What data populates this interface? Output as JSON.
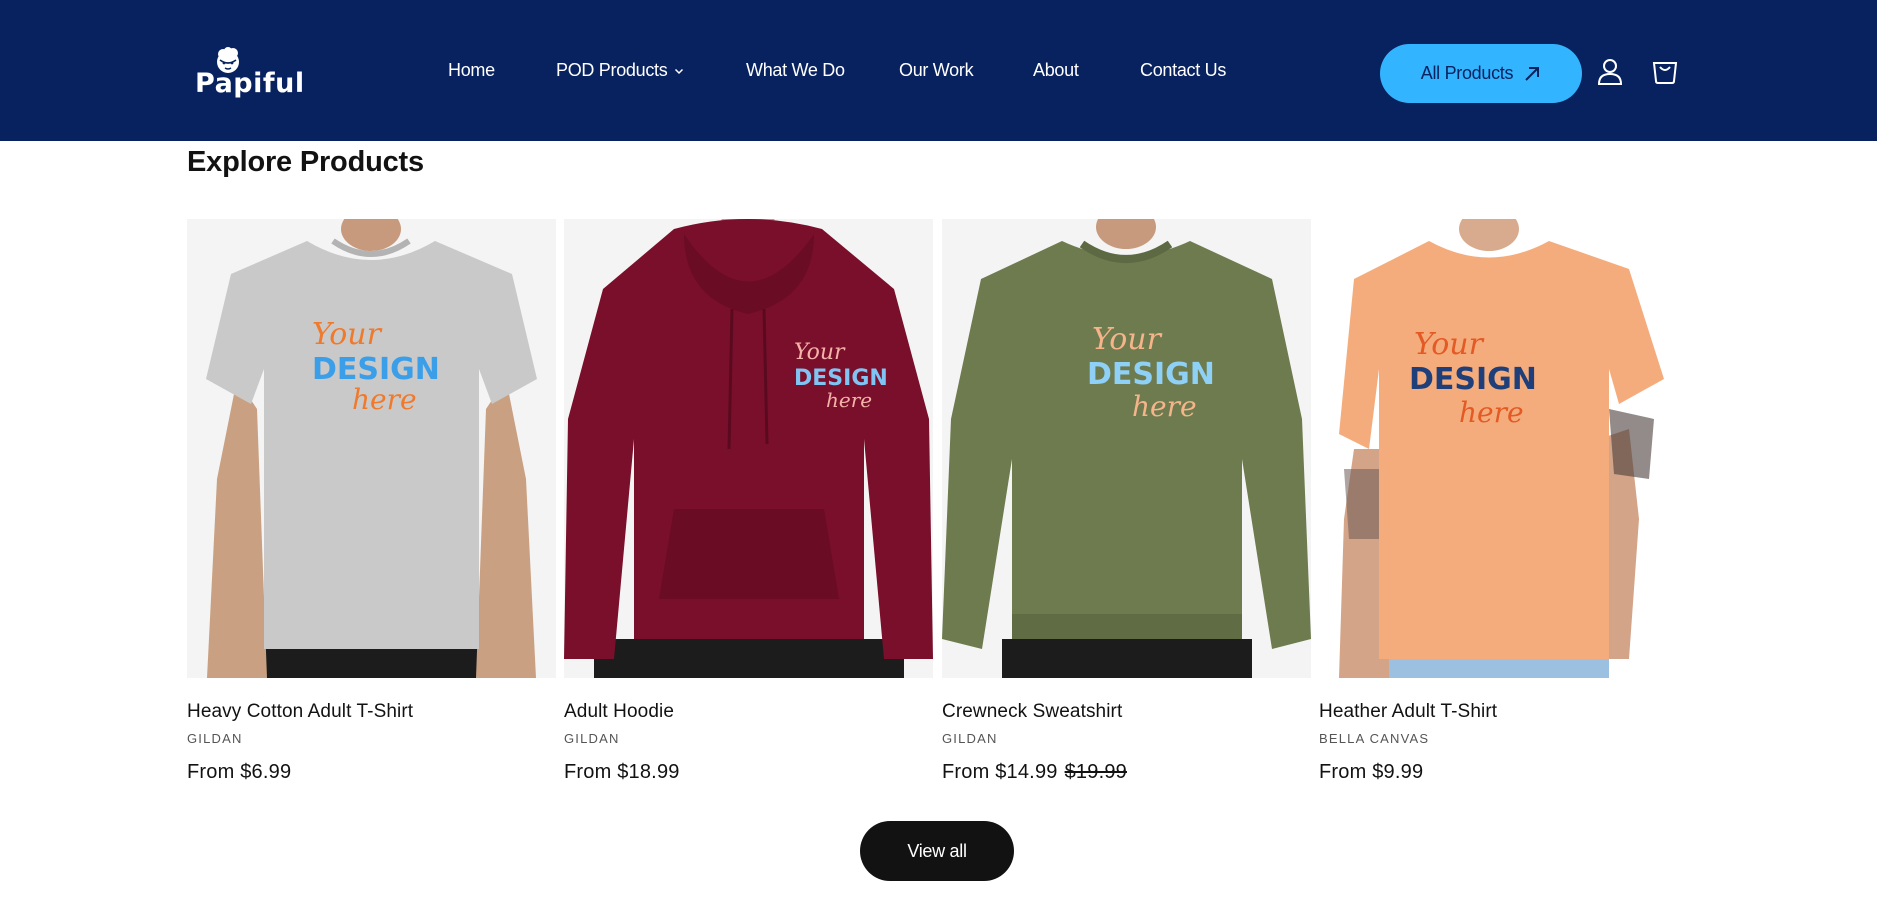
{
  "header": {
    "logo_text": "Papiful",
    "nav": [
      {
        "label": "Home"
      },
      {
        "label": "POD Products"
      },
      {
        "label": "What We Do"
      },
      {
        "label": "Our Work"
      },
      {
        "label": "About"
      },
      {
        "label": "Contact Us"
      }
    ],
    "cta_label": "All Products",
    "icons": [
      "account-icon",
      "cart-icon",
      "arrow-up-right-icon",
      "chevron-down-icon"
    ]
  },
  "colors": {
    "header_bg": "#08225f",
    "cta_bg": "#33b4ff",
    "button_dark": "#121212"
  },
  "section": {
    "title": "Explore Products",
    "view_all_label": "View all"
  },
  "products": [
    {
      "title": "Heavy Cotton Adult T-Shirt",
      "vendor": "GILDAN",
      "price": "From $6.99",
      "compare_price": "",
      "garment": "t-shirt",
      "garment_color": "#c9c9c9"
    },
    {
      "title": "Adult Hoodie",
      "vendor": "GILDAN",
      "price": "From $18.99",
      "compare_price": "",
      "garment": "hoodie",
      "garment_color": "#7a0f2b"
    },
    {
      "title": "Crewneck Sweatshirt",
      "vendor": "GILDAN",
      "price": "From $14.99",
      "compare_price": "$19.99",
      "garment": "sweatshirt",
      "garment_color": "#6d7b4f"
    },
    {
      "title": "Heather Adult T-Shirt",
      "vendor": "BELLA CANVAS",
      "price": "From $9.99",
      "compare_price": "",
      "garment": "t-shirt",
      "garment_color": "#f5ac7c"
    }
  ],
  "print_text": [
    "Your",
    "DESIGN",
    "here"
  ]
}
